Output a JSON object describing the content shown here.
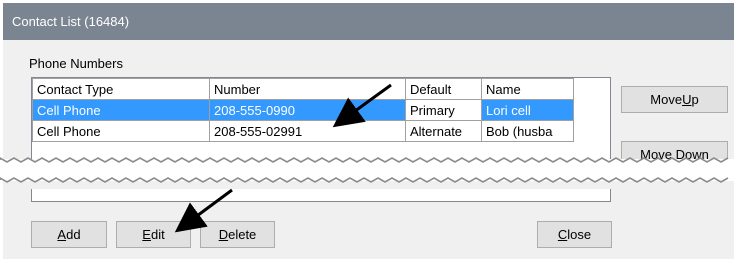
{
  "window": {
    "title": "Contact List (16484)"
  },
  "phone_group": {
    "label": "Phone Numbers"
  },
  "table": {
    "columns": [
      "Contact Type",
      "Number",
      "Default",
      "Name"
    ],
    "rows": [
      {
        "contact_type": "Cell Phone",
        "number": "208-555-0990",
        "default": "Primary",
        "name": "Lori cell"
      },
      {
        "contact_type": "Cell Phone",
        "number": "208-555-02991",
        "default": "Alternate",
        "name": "Bob (husba"
      }
    ]
  },
  "buttons": {
    "move_up": {
      "pre": "Move ",
      "u": "U",
      "post": "p"
    },
    "move_down": {
      "pre": "Move Dow",
      "u": "n",
      "post": ""
    },
    "add": {
      "pre": "",
      "u": "A",
      "post": "dd"
    },
    "edit": {
      "pre": "",
      "u": "E",
      "post": "dit"
    },
    "delete": {
      "pre": "",
      "u": "D",
      "post": "elete"
    },
    "close": {
      "pre": "",
      "u": "C",
      "post": "lose"
    }
  },
  "colors": {
    "titlebar": "#7b8591",
    "selection": "#3399ff"
  }
}
